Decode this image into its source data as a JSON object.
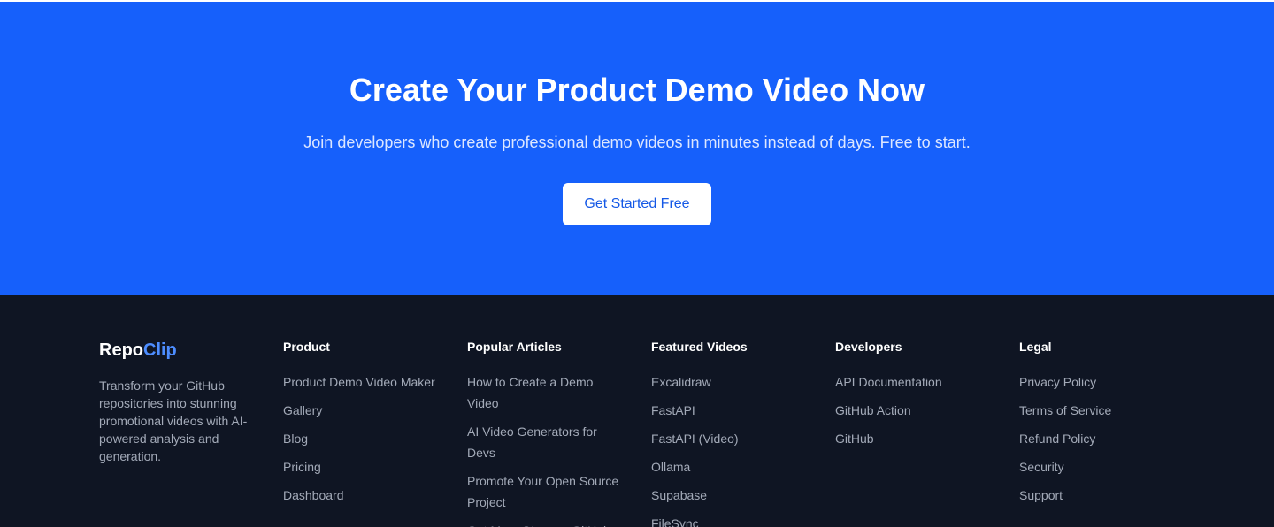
{
  "cta": {
    "title": "Create Your Product Demo Video Now",
    "subtitle": "Join developers who create professional demo videos in minutes instead of days. Free to start.",
    "button_label": "Get Started Free"
  },
  "footer": {
    "brand": {
      "name_part1": "Repo",
      "name_part2": "Clip",
      "description": "Transform your GitHub repositories into stunning promotional videos with AI-powered analysis and generation."
    },
    "columns": [
      {
        "title": "Product",
        "links": [
          "Product Demo Video Maker",
          "Gallery",
          "Blog",
          "Pricing",
          "Dashboard"
        ]
      },
      {
        "title": "Popular Articles",
        "links": [
          "How to Create a Demo Video",
          "AI Video Generators for Devs",
          "Promote Your Open Source Project",
          "Get More Stars on GitHub"
        ]
      },
      {
        "title": "Featured Videos",
        "links": [
          "Excalidraw",
          "FastAPI",
          "FastAPI (Video)",
          "Ollama",
          "Supabase",
          "FileSync"
        ]
      },
      {
        "title": "Developers",
        "links": [
          "API Documentation",
          "GitHub Action",
          "GitHub"
        ]
      },
      {
        "title": "Legal",
        "links": [
          "Privacy Policy",
          "Terms of Service",
          "Refund Policy",
          "Security",
          "Support"
        ]
      }
    ]
  },
  "colors": {
    "cta_background": "#1660fb",
    "footer_background": "#0f1523",
    "brand_accent": "#4d8dff",
    "link_text": "#a3aab8"
  }
}
